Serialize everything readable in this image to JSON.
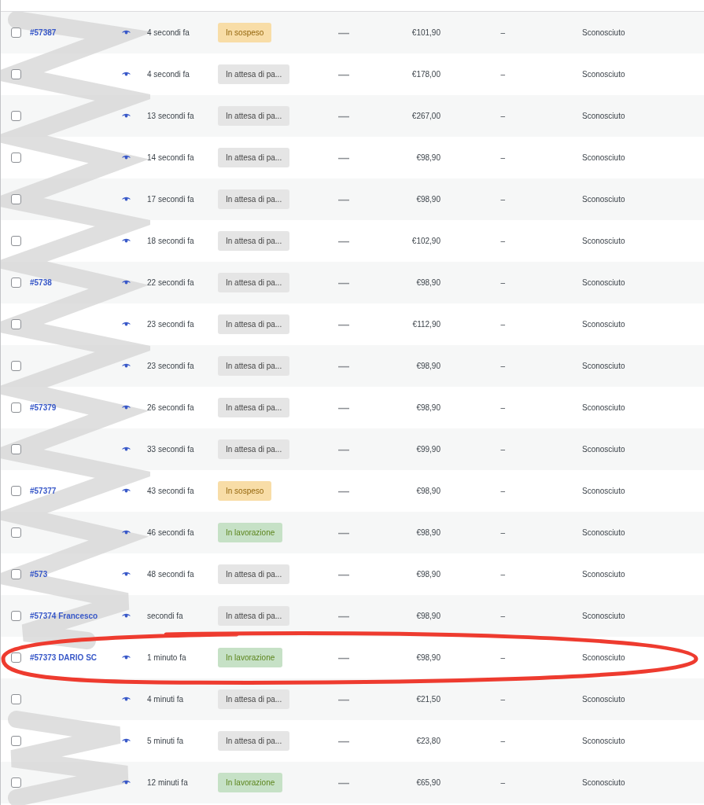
{
  "orders": [
    {
      "order": "#57387",
      "date": "4 secondi fa",
      "status": {
        "kind": "on-hold",
        "label": "In sospeso"
      },
      "origin": "—",
      "total": "€101,90",
      "col_7": "–",
      "col_9": "Sconosciuto",
      "checked": false
    },
    {
      "date": "4 secondi fa",
      "status": {
        "kind": "pending",
        "label": "In attesa di pa..."
      },
      "origin": "—",
      "total": "€178,00",
      "col_7": "–",
      "col_9": "Sconosciuto",
      "checked": false
    },
    {
      "date": "13 secondi fa",
      "status": {
        "kind": "pending",
        "label": "In attesa di pa..."
      },
      "origin": "—",
      "total": "€267,00",
      "col_7": "–",
      "col_9": "Sconosciuto",
      "checked": false
    },
    {
      "date": "14 secondi fa",
      "status": {
        "kind": "pending",
        "label": "In attesa di pa..."
      },
      "origin": "—",
      "total": "€98,90",
      "col_7": "–",
      "col_9": "Sconosciuto",
      "checked": false
    },
    {
      "date": "17 secondi fa",
      "status": {
        "kind": "pending",
        "label": "In attesa di pa..."
      },
      "origin": "—",
      "total": "€98,90",
      "col_7": "–",
      "col_9": "Sconosciuto",
      "checked": false
    },
    {
      "date": "18 secondi fa",
      "status": {
        "kind": "pending",
        "label": "In attesa di pa..."
      },
      "origin": "—",
      "total": "€102,90",
      "col_7": "–",
      "col_9": "Sconosciuto",
      "checked": false
    },
    {
      "order": "#5738",
      "date": "22 secondi fa",
      "status": {
        "kind": "pending",
        "label": "In attesa di pa..."
      },
      "origin": "—",
      "total": "€98,90",
      "col_7": "–",
      "col_9": "Sconosciuto",
      "checked": false
    },
    {
      "date": "23 secondi fa",
      "status": {
        "kind": "pending",
        "label": "In attesa di pa..."
      },
      "origin": "—",
      "total": "€112,90",
      "col_7": "–",
      "col_9": "Sconosciuto",
      "checked": false
    },
    {
      "date": "23 secondi fa",
      "status": {
        "kind": "pending",
        "label": "In attesa di pa..."
      },
      "origin": "—",
      "total": "€98,90",
      "col_7": "–",
      "col_9": "Sconosciuto",
      "checked": false
    },
    {
      "order": "#57379",
      "date": "26 secondi fa",
      "status": {
        "kind": "pending",
        "label": "In attesa di pa..."
      },
      "origin": "—",
      "total": "€98,90",
      "col_7": "–",
      "col_9": "Sconosciuto",
      "checked": false
    },
    {
      "date": "33 secondi fa",
      "status": {
        "kind": "pending",
        "label": "In attesa di pa..."
      },
      "origin": "—",
      "total": "€99,90",
      "col_7": "–",
      "col_9": "Sconosciuto",
      "checked": false
    },
    {
      "order": "#57377",
      "date": "43 secondi fa",
      "status": {
        "kind": "on-hold",
        "label": "In sospeso"
      },
      "origin": "—",
      "total": "€98,90",
      "col_7": "–",
      "col_9": "Sconosciuto",
      "checked": false
    },
    {
      "date": "46 secondi fa",
      "status": {
        "kind": "processing",
        "label": "In lavorazione"
      },
      "origin": "—",
      "total": "€98,90",
      "col_7": "–",
      "col_9": "Sconosciuto",
      "checked": false
    },
    {
      "order": "#573",
      "date": "48 secondi fa",
      "status": {
        "kind": "pending",
        "label": "In attesa di pa..."
      },
      "origin": "—",
      "total": "€98,90",
      "col_7": "–",
      "col_9": "Sconosciuto",
      "checked": false
    },
    {
      "order": "#57374 Francesco",
      "date": "secondi fa",
      "status": {
        "kind": "pending",
        "label": "In attesa di pa..."
      },
      "origin": "—",
      "total": "€98,90",
      "col_7": "–",
      "col_9": "Sconosciuto",
      "checked": false
    },
    {
      "order": "#57373 DARIO SC",
      "date": "1 minuto fa",
      "status": {
        "kind": "processing",
        "label": "In lavorazione"
      },
      "origin": "—",
      "total": "€98,90",
      "col_7": "–",
      "col_9": "Sconosciuto",
      "checked": false
    },
    {
      "date": "4 minuti fa",
      "status": {
        "kind": "pending",
        "label": "In attesa di pa..."
      },
      "origin": "—",
      "total": "€21,50",
      "col_7": "–",
      "col_9": "Sconosciuto",
      "checked": false
    },
    {
      "date": "5 minuti fa",
      "status": {
        "kind": "pending",
        "label": "In attesa di pa..."
      },
      "origin": "—",
      "total": "€23,80",
      "col_7": "–",
      "col_9": "Sconosciuto",
      "checked": false
    },
    {
      "date": "12 minuti fa",
      "status": {
        "kind": "processing",
        "label": "In lavorazione"
      },
      "origin": "—",
      "total": "€65,90",
      "col_7": "–",
      "col_9": "Sconosciuto",
      "checked": false
    }
  ]
}
